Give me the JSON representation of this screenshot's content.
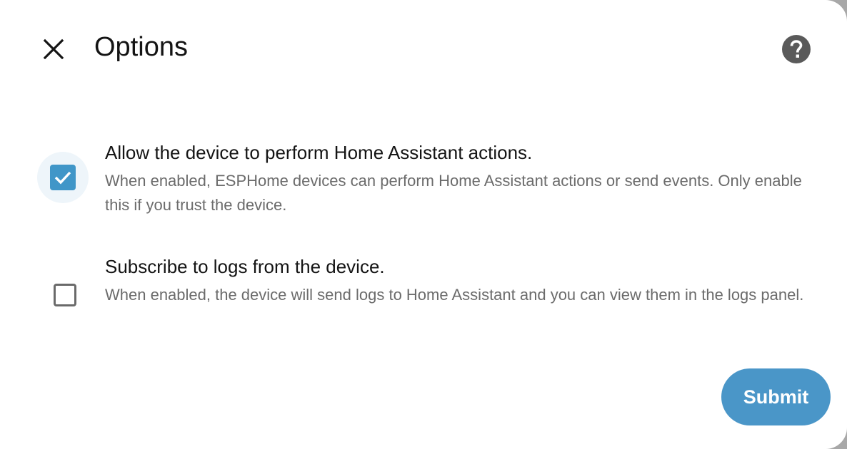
{
  "dialog": {
    "title": "Options",
    "close_icon": "close-icon",
    "help_icon": "help-circle-icon"
  },
  "options": [
    {
      "label": "Allow the device to perform Home Assistant actions.",
      "description": "When enabled, ESPHome devices can perform Home Assistant actions or send events. Only enable this if you trust the device.",
      "checked": true
    },
    {
      "label": "Subscribe to logs from the device.",
      "description": "When enabled, the device will send logs to Home Assistant and you can view them in the logs panel.",
      "checked": false
    }
  ],
  "footer": {
    "submit_label": "Submit"
  },
  "colors": {
    "accent": "#4096c8",
    "button": "#4a96c8",
    "text_primary": "#141414",
    "text_secondary": "#6b6b6b"
  }
}
